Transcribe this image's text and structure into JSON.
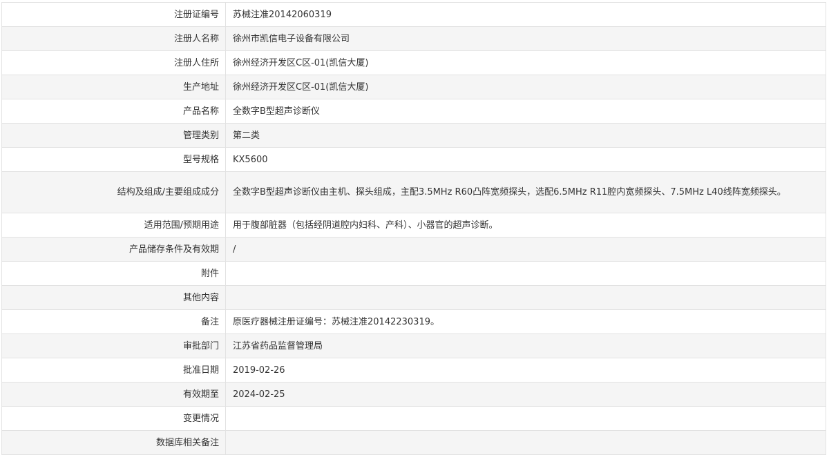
{
  "rows": [
    {
      "label": "注册证编号",
      "value": "苏械注准20142060319"
    },
    {
      "label": "注册人名称",
      "value": "徐州市凯信电子设备有限公司"
    },
    {
      "label": "注册人住所",
      "value": "徐州经济开发区C区-01(凯信大厦)"
    },
    {
      "label": "生产地址",
      "value": "徐州经济开发区C区-01(凯信大厦)"
    },
    {
      "label": "产品名称",
      "value": "全数字B型超声诊断仪"
    },
    {
      "label": "管理类别",
      "value": "第二类"
    },
    {
      "label": "型号规格",
      "value": "KX5600"
    },
    {
      "label": "结构及组成/主要组成成分",
      "value": "全数字B型超声诊断仪由主机、探头组成，主配3.5MHz R60凸阵宽频探头，选配6.5MHz R11腔内宽频探头、7.5MHz L40线阵宽频探头。"
    },
    {
      "label": "适用范围/预期用途",
      "value": "用于腹部脏器（包括经阴道腔内妇科、产科）、小器官的超声诊断。"
    },
    {
      "label": "产品储存条件及有效期",
      "value": "/"
    },
    {
      "label": "附件",
      "value": ""
    },
    {
      "label": "其他内容",
      "value": ""
    },
    {
      "label": "备注",
      "value": "原医疗器械注册证编号：苏械注准20142230319。"
    },
    {
      "label": "审批部门",
      "value": "江苏省药品监督管理局"
    },
    {
      "label": "批准日期",
      "value": "2019-02-26"
    },
    {
      "label": "有效期至",
      "value": "2024-02-25"
    },
    {
      "label": "变更情况",
      "value": ""
    },
    {
      "label": "数据库相关备注",
      "value": ""
    }
  ]
}
